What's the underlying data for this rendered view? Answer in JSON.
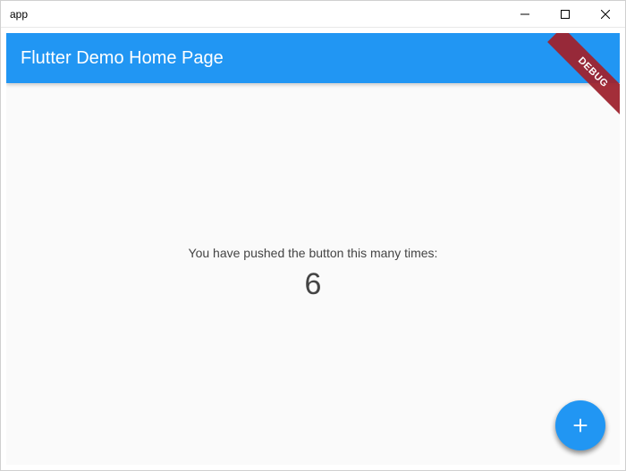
{
  "window": {
    "title": "app"
  },
  "appbar": {
    "title": "Flutter Demo Home Page"
  },
  "debug_banner": {
    "label": "DEBUG"
  },
  "main": {
    "push_text": "You have pushed the button this many times:",
    "counter": "6"
  },
  "fab": {
    "icon_name": "plus-icon"
  },
  "colors": {
    "primary": "#2196f3",
    "debug_banner": "#9e232e",
    "background": "#fafafa"
  }
}
